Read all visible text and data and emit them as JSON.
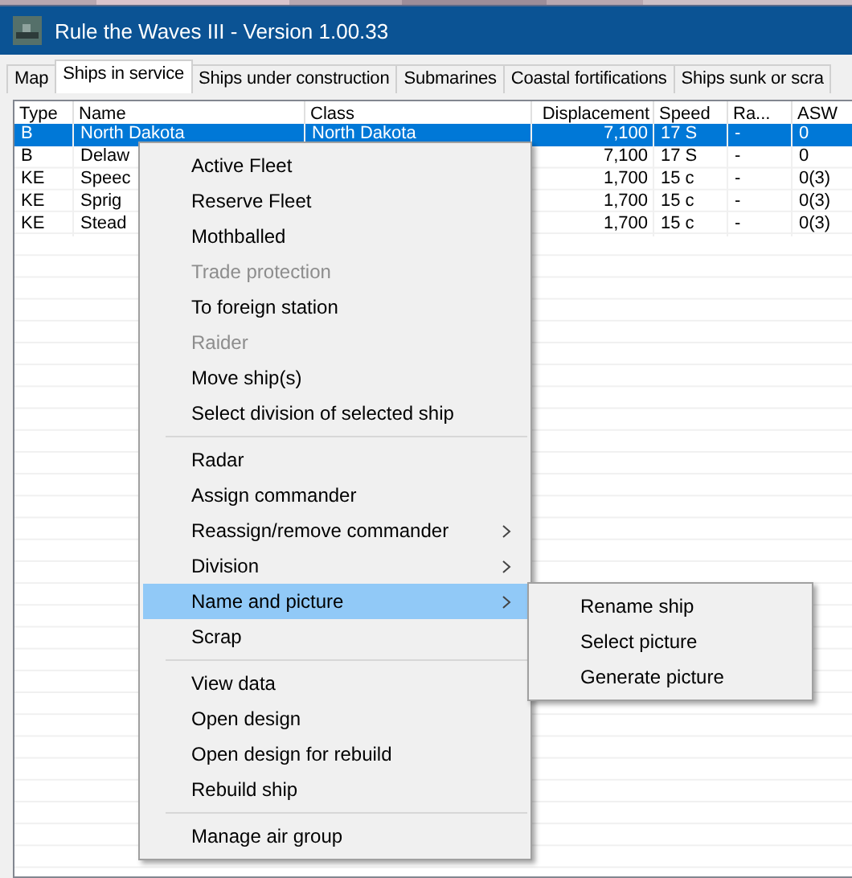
{
  "window": {
    "title": "Rule the Waves III - Version 1.00.33"
  },
  "tabs": [
    {
      "label": "Map",
      "selected": false
    },
    {
      "label": "Ships in service",
      "selected": true
    },
    {
      "label": "Ships under construction",
      "selected": false
    },
    {
      "label": "Submarines",
      "selected": false
    },
    {
      "label": "Coastal fortifications",
      "selected": false
    },
    {
      "label": "Ships sunk or scra",
      "selected": false
    }
  ],
  "table": {
    "columns": [
      "Type",
      "Name",
      "Class",
      "Displacement",
      "Speed",
      "Ra...",
      "ASW"
    ],
    "rows": [
      {
        "selected": true,
        "cells": [
          "B",
          "North Dakota",
          "North Dakota",
          "7,100",
          "17 S",
          "-",
          "0"
        ]
      },
      {
        "selected": false,
        "cells": [
          "B",
          "Delaw",
          "",
          "7,100",
          "17 S",
          "-",
          "0"
        ]
      },
      {
        "selected": false,
        "cells": [
          "KE",
          "Speec",
          "",
          "1,700",
          "15 c",
          "-",
          "0(3)"
        ]
      },
      {
        "selected": false,
        "cells": [
          "KE",
          "Sprig",
          "",
          "1,700",
          "15 c",
          "-",
          "0(3)"
        ]
      },
      {
        "selected": false,
        "cells": [
          "KE",
          "Stead",
          "",
          "1,700",
          "15 c",
          "-",
          "0(3)"
        ]
      }
    ]
  },
  "context_menu": {
    "items": [
      {
        "kind": "item",
        "label": "Active Fleet",
        "disabled": false,
        "submenu": false,
        "selected": false
      },
      {
        "kind": "item",
        "label": "Reserve Fleet",
        "disabled": false,
        "submenu": false,
        "selected": false
      },
      {
        "kind": "item",
        "label": "Mothballed",
        "disabled": false,
        "submenu": false,
        "selected": false
      },
      {
        "kind": "item",
        "label": "Trade protection",
        "disabled": true,
        "submenu": false,
        "selected": false
      },
      {
        "kind": "item",
        "label": "To foreign station",
        "disabled": false,
        "submenu": false,
        "selected": false
      },
      {
        "kind": "item",
        "label": "Raider",
        "disabled": true,
        "submenu": false,
        "selected": false
      },
      {
        "kind": "item",
        "label": "Move ship(s)",
        "disabled": false,
        "submenu": false,
        "selected": false
      },
      {
        "kind": "item",
        "label": "Select division of selected ship",
        "disabled": false,
        "submenu": false,
        "selected": false
      },
      {
        "kind": "separator"
      },
      {
        "kind": "item",
        "label": "Radar",
        "disabled": false,
        "submenu": false,
        "selected": false
      },
      {
        "kind": "item",
        "label": "Assign commander",
        "disabled": false,
        "submenu": false,
        "selected": false
      },
      {
        "kind": "item",
        "label": "Reassign/remove commander",
        "disabled": false,
        "submenu": true,
        "selected": false
      },
      {
        "kind": "item",
        "label": "Division",
        "disabled": false,
        "submenu": true,
        "selected": false
      },
      {
        "kind": "item",
        "label": "Name and picture",
        "disabled": false,
        "submenu": true,
        "selected": true
      },
      {
        "kind": "item",
        "label": "Scrap",
        "disabled": false,
        "submenu": false,
        "selected": false
      },
      {
        "kind": "separator"
      },
      {
        "kind": "item",
        "label": "View data",
        "disabled": false,
        "submenu": false,
        "selected": false
      },
      {
        "kind": "item",
        "label": "Open design",
        "disabled": false,
        "submenu": false,
        "selected": false
      },
      {
        "kind": "item",
        "label": "Open design for rebuild",
        "disabled": false,
        "submenu": false,
        "selected": false
      },
      {
        "kind": "item",
        "label": "Rebuild ship",
        "disabled": false,
        "submenu": false,
        "selected": false
      },
      {
        "kind": "separator"
      },
      {
        "kind": "item",
        "label": "Manage air group",
        "disabled": false,
        "submenu": false,
        "selected": false
      }
    ]
  },
  "submenu": {
    "items": [
      "Rename ship",
      "Select picture",
      "Generate picture"
    ]
  }
}
